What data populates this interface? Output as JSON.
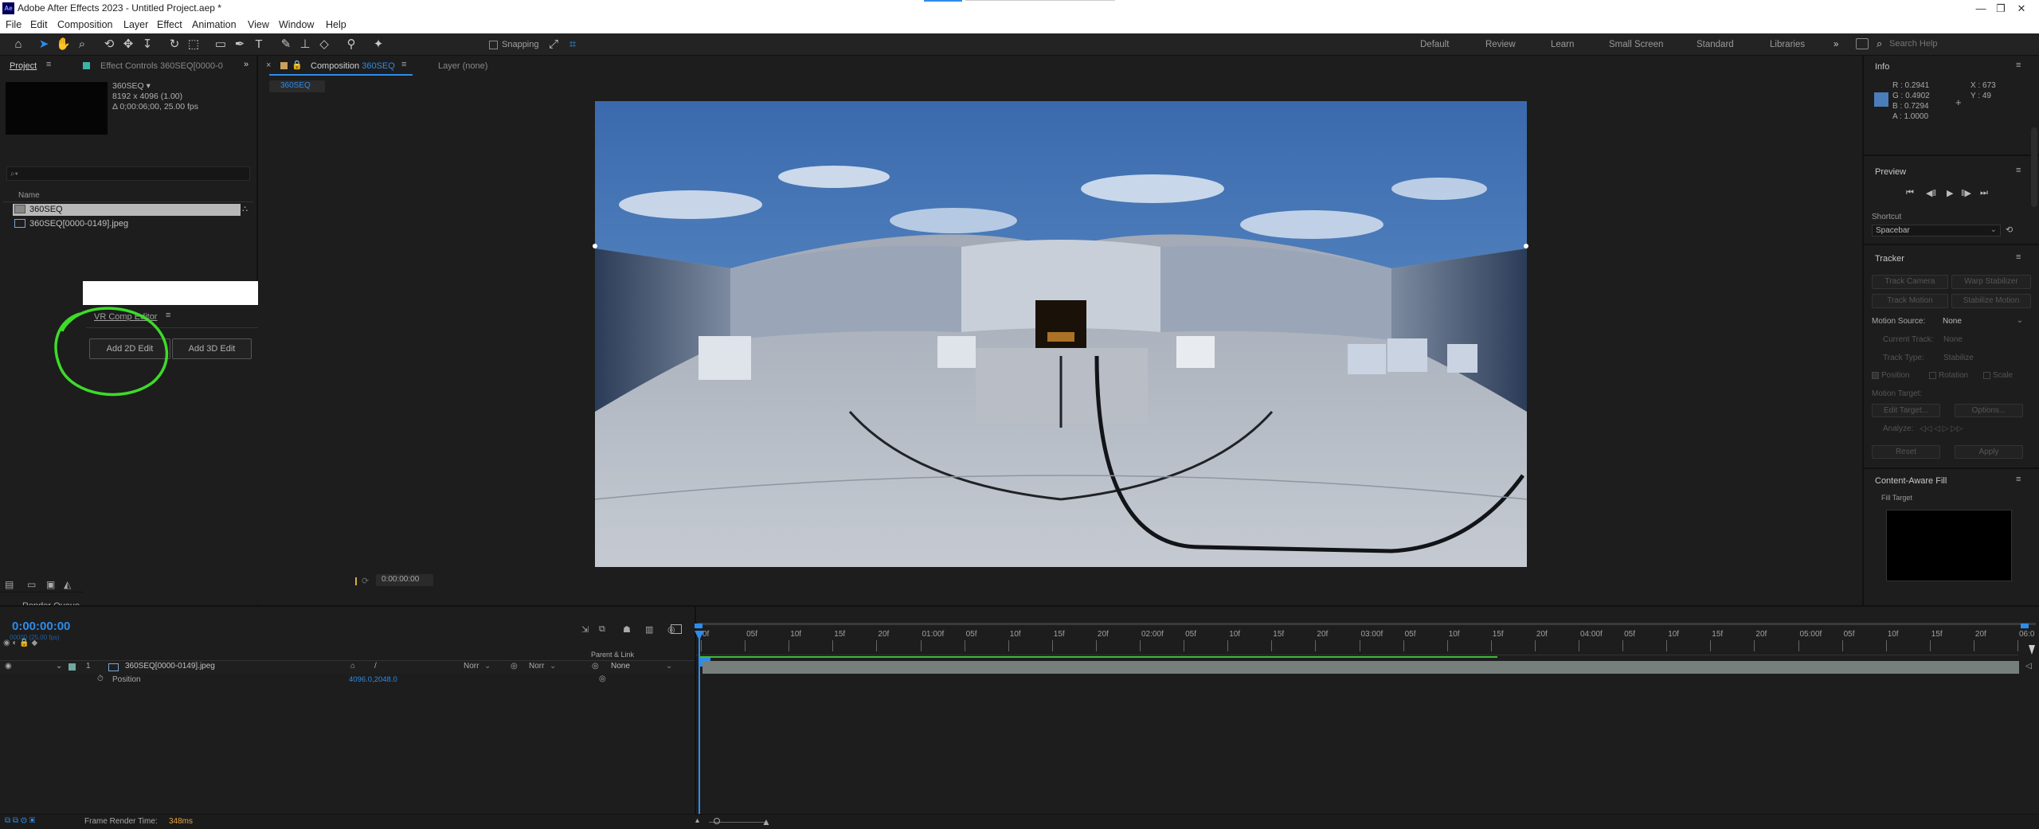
{
  "app": {
    "title": "Adobe After Effects 2023 - Untitled Project.aep *",
    "logo": "Ae"
  },
  "window_controls": [
    "—",
    "❐",
    "✕"
  ],
  "menu": [
    "File",
    "Edit",
    "Composition",
    "Layer",
    "Effect",
    "Animation",
    "View",
    "Window",
    "Help"
  ],
  "toolbar": {
    "snapping": "Snapping"
  },
  "workspaces": [
    "Default",
    "Review",
    "Learn",
    "Small Screen",
    "Standard",
    "Libraries"
  ],
  "search": {
    "placeholder": "Search Help"
  },
  "project": {
    "tab": "Project",
    "effect_controls": "Effect Controls 360SEQ[0000-0",
    "item_name": "360SEQ ▾",
    "item_dims": "8192 x 4096 (1.00)",
    "item_duration": "Δ 0;00:06;00, 25.00 fps",
    "search_placeholder": "⌕▾",
    "col_name": "Name",
    "items": [
      "360SEQ",
      "360SEQ[0000-0149].jpeg"
    ]
  },
  "vr": {
    "title": "VR Comp Editor",
    "add2d": "Add 2D Edit",
    "add3d": "Add 3D Edit"
  },
  "render_queue": {
    "title": "Render Queue"
  },
  "composition": {
    "tab": "Composition",
    "comp_name": "360SEQ",
    "layer_tab": "Layer (none)",
    "breadcrumb": "360SEQ",
    "timecode": "0:00:00:00"
  },
  "info": {
    "title": "Info",
    "r": "R : 0.2941",
    "g": "G : 0.4902",
    "b": "B : 0.7294",
    "a": "A : 1.0000",
    "x": "X : 673",
    "y": "Y : 49",
    "swatch": "#4b7dba"
  },
  "preview": {
    "title": "Preview",
    "shortcut_label": "Shortcut",
    "shortcut_value": "Spacebar"
  },
  "tracker": {
    "title": "Tracker",
    "track_camera": "Track Camera",
    "warp_stabilizer": "Warp Stabilizer",
    "track_motion": "Track Motion",
    "stabilize_motion": "Stabilize Motion",
    "motion_source_label": "Motion Source:",
    "motion_source_value": "None",
    "current_track_label": "Current Track:",
    "current_track_value": "None",
    "track_type_label": "Track Type:",
    "track_type_value": "Stabilize",
    "position": "Position",
    "rotation": "Rotation",
    "scale": "Scale",
    "motion_target": "Motion Target:",
    "edit_target": "Edit Target...",
    "options": "Options...",
    "analyze": "Analyze:",
    "reset": "Reset",
    "apply": "Apply"
  },
  "caf": {
    "title": "Content-Aware Fill",
    "fill_target": "Fill Target"
  },
  "timeline": {
    "timecode": "0:00:00:00",
    "fps": "00000 (25.00 fps)",
    "parent_link": "Parent & Link",
    "layer_num": "1",
    "layer_name": "360SEQ[0000-0149].jpeg",
    "mode1": "Norr",
    "mode2": "Norr",
    "parent_value": "None",
    "position_label": "Position",
    "position_value": "4096.0,2048.0",
    "ticks": [
      "0f",
      "05f",
      "10f",
      "15f",
      "20f",
      "01:00f",
      "05f",
      "10f",
      "15f",
      "20f",
      "02:00f",
      "05f",
      "10f",
      "15f",
      "20f",
      "03:00f",
      "05f",
      "10f",
      "15f",
      "20f",
      "04:00f",
      "05f",
      "10f",
      "15f",
      "20f",
      "05:00f",
      "05f",
      "10f",
      "15f",
      "20f",
      "06:0"
    ]
  },
  "status": {
    "label": "Frame Render Time:",
    "value": "348ms"
  },
  "annotation_color": "#3cdc28"
}
